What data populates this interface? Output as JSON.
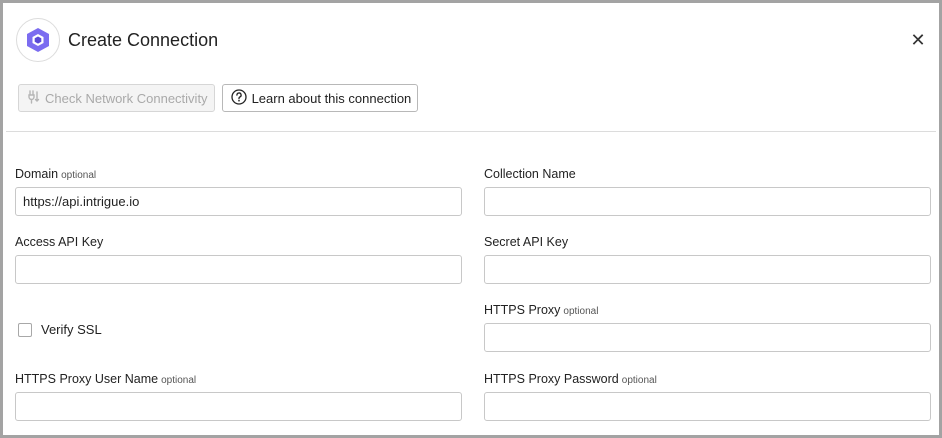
{
  "dialog": {
    "title": "Create Connection",
    "close_glyph": "✕"
  },
  "toolbar": {
    "check_network_label": "Check Network Connectivity",
    "learn_label": "Learn about this connection"
  },
  "form": {
    "optional_tag": "optional",
    "domain": {
      "label": "Domain",
      "value": "https://api.intrigue.io"
    },
    "collection_name": {
      "label": "Collection Name",
      "value": ""
    },
    "access_api_key": {
      "label": "Access API Key",
      "value": ""
    },
    "secret_api_key": {
      "label": "Secret API Key",
      "value": ""
    },
    "verify_ssl": {
      "label": "Verify SSL",
      "checked": false
    },
    "https_proxy": {
      "label": "HTTPS Proxy",
      "value": ""
    },
    "https_proxy_user": {
      "label": "HTTPS Proxy User Name",
      "value": ""
    },
    "https_proxy_password": {
      "label": "HTTPS Proxy Password",
      "value": ""
    }
  },
  "icons": {
    "logo": "intrigue-hexagon-logo-icon",
    "check_network": "network-plug-icon",
    "learn": "question-circle-icon",
    "close": "close-icon"
  },
  "colors": {
    "logo_outer": "#7b6cf0",
    "logo_inner": "#5a4ad6",
    "border": "#a3a3a3"
  }
}
